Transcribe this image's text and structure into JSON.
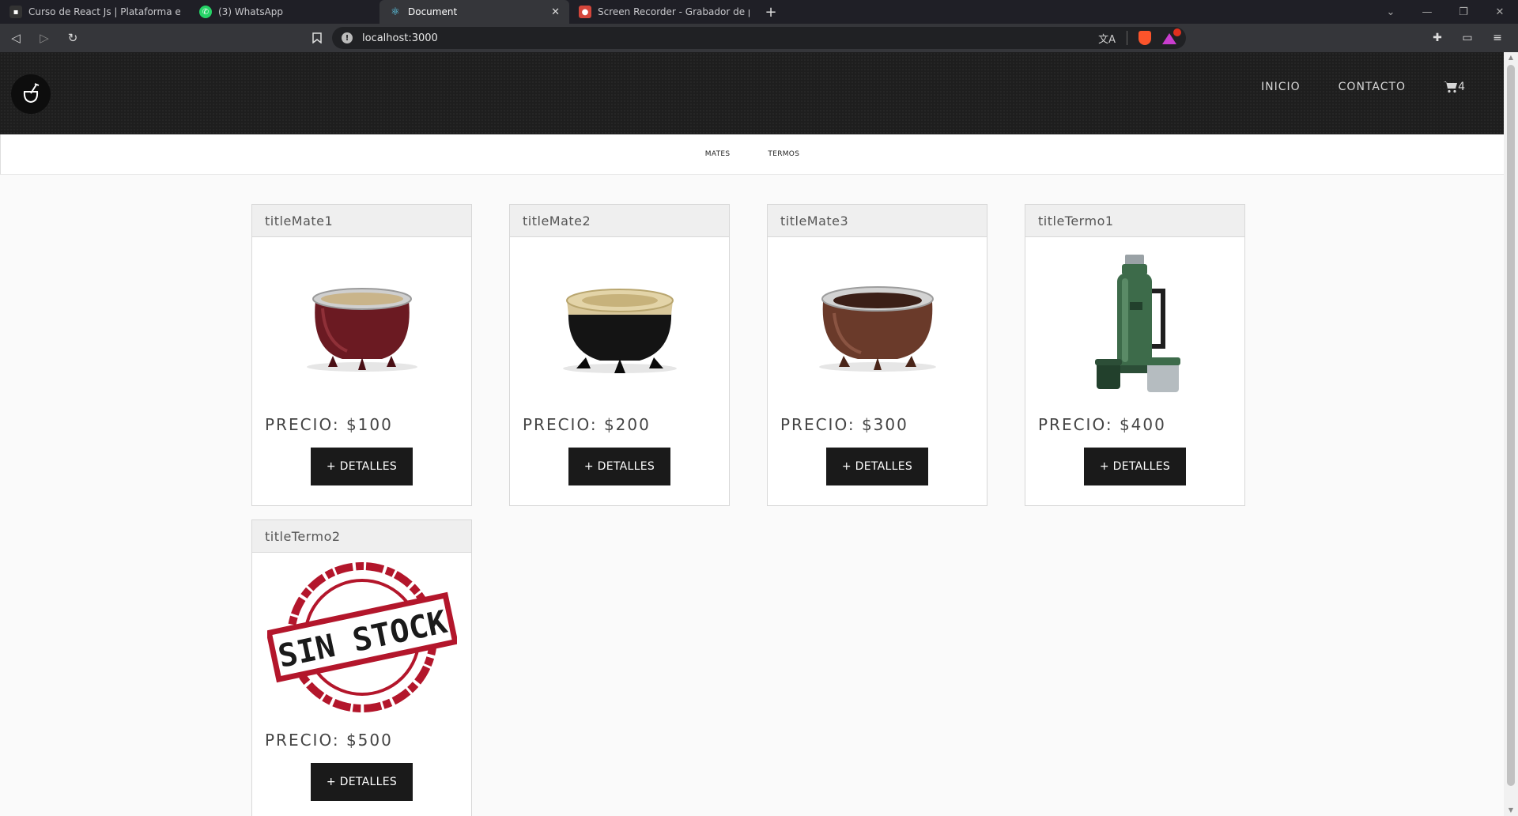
{
  "browser": {
    "tabs": [
      {
        "title": "Curso de React Js | Plataforma eLearn",
        "active": false
      },
      {
        "title": "(3) WhatsApp",
        "active": false
      },
      {
        "title": "Document",
        "active": true
      },
      {
        "title": "Screen Recorder - Grabador de pantal",
        "active": false
      }
    ],
    "url": "localhost:3000"
  },
  "header": {
    "nav": [
      {
        "label": "INICIO"
      },
      {
        "label": "CONTACTO"
      }
    ],
    "cart_count": "4"
  },
  "categories": [
    {
      "label": "MATES"
    },
    {
      "label": "TERMOS"
    }
  ],
  "products": [
    {
      "title": "titleMate1",
      "price": "PRECIO: $100",
      "button": "+ DETALLES",
      "image": "mate-bordo",
      "color": "#6b1a22"
    },
    {
      "title": "titleMate2",
      "price": "PRECIO: $200",
      "button": "+ DETALLES",
      "image": "mate-negro",
      "color": "#1a1a1a"
    },
    {
      "title": "titleMate3",
      "price": "PRECIO: $300",
      "button": "+ DETALLES",
      "image": "mate-marron",
      "color": "#6a3a2a"
    },
    {
      "title": "titleTermo1",
      "price": "PRECIO: $400",
      "button": "+ DETALLES",
      "image": "termo-verde",
      "color": "#3d6b4a"
    },
    {
      "title": "titleTermo2",
      "price": "PRECIO: $500",
      "button": "+ DETALLES",
      "image": "sin-stock",
      "stamp_text": "SIN STOCK",
      "color": "#b3162b"
    }
  ]
}
